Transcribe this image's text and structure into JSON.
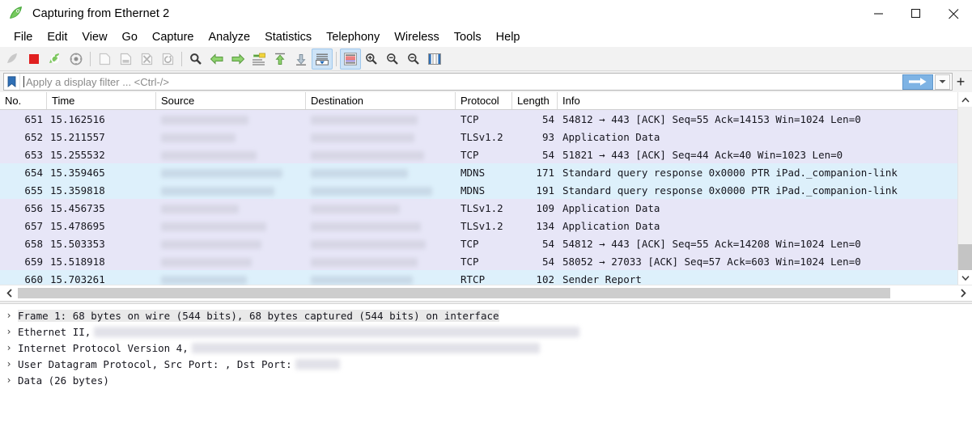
{
  "window": {
    "title": "Capturing from Ethernet 2",
    "app_icon": "wireshark-fin-icon",
    "controls": [
      {
        "name": "minimize",
        "glyph": "minimize-icon"
      },
      {
        "name": "maximize",
        "glyph": "maximize-icon"
      },
      {
        "name": "close",
        "glyph": "close-icon"
      }
    ]
  },
  "menubar": {
    "items": [
      "File",
      "Edit",
      "View",
      "Go",
      "Capture",
      "Analyze",
      "Statistics",
      "Telephony",
      "Wireless",
      "Tools",
      "Help"
    ]
  },
  "toolbar": {
    "buttons": [
      {
        "name": "start-capture-icon",
        "state": "disabled"
      },
      {
        "name": "stop-capture-icon",
        "state": "enabled"
      },
      {
        "name": "restart-capture-icon",
        "state": "enabled"
      },
      {
        "name": "capture-options-icon",
        "state": "enabled"
      },
      {
        "name": "separator",
        "state": "sep"
      },
      {
        "name": "open-file-icon",
        "state": "disabled"
      },
      {
        "name": "save-file-icon",
        "state": "disabled"
      },
      {
        "name": "close-file-icon",
        "state": "disabled"
      },
      {
        "name": "reload-file-icon",
        "state": "disabled"
      },
      {
        "name": "separator",
        "state": "sep"
      },
      {
        "name": "find-packet-icon",
        "state": "enabled"
      },
      {
        "name": "go-back-icon",
        "state": "enabled"
      },
      {
        "name": "go-forward-icon",
        "state": "enabled"
      },
      {
        "name": "go-to-packet-icon",
        "state": "enabled"
      },
      {
        "name": "go-to-first-packet-icon",
        "state": "enabled"
      },
      {
        "name": "go-to-last-packet-icon",
        "state": "enabled"
      },
      {
        "name": "auto-scroll-icon",
        "state": "active"
      },
      {
        "name": "separator",
        "state": "sep"
      },
      {
        "name": "colorize-packets-icon",
        "state": "active"
      },
      {
        "name": "zoom-in-icon",
        "state": "enabled"
      },
      {
        "name": "zoom-out-icon",
        "state": "enabled"
      },
      {
        "name": "normal-size-icon",
        "state": "enabled"
      },
      {
        "name": "resize-columns-icon",
        "state": "enabled"
      }
    ]
  },
  "filter": {
    "placeholder": "Apply a display filter ... <Ctrl-/>",
    "value": "",
    "bookmark_icon": "filter-bookmark-icon",
    "apply_icon": "apply-filter-arrow-icon",
    "dropdown_icon": "filter-history-dropdown-icon",
    "add_icon": "add-filter-button-icon"
  },
  "packet_list": {
    "columns": [
      {
        "key": "no",
        "label": "No."
      },
      {
        "key": "time",
        "label": "Time"
      },
      {
        "key": "src",
        "label": "Source"
      },
      {
        "key": "dst",
        "label": "Destination"
      },
      {
        "key": "proto",
        "label": "Protocol"
      },
      {
        "key": "len",
        "label": "Length"
      },
      {
        "key": "info",
        "label": "Info"
      }
    ],
    "rows": [
      {
        "no": "651",
        "time": "15.162516",
        "src": "",
        "dst": "",
        "proto": "TCP",
        "len": "54",
        "info": "54812 → 443 [ACK] Seq=55 Ack=14153 Win=1024 Len=0",
        "style": "tcp"
      },
      {
        "no": "652",
        "time": "15.211557",
        "src": "",
        "dst": "",
        "proto": "TLSv1.2",
        "len": "93",
        "info": "Application Data",
        "style": "tcp"
      },
      {
        "no": "653",
        "time": "15.255532",
        "src": "",
        "dst": "",
        "proto": "TCP",
        "len": "54",
        "info": "51821 → 443 [ACK] Seq=44 Ack=40 Win=1023 Len=0",
        "style": "tcp"
      },
      {
        "no": "654",
        "time": "15.359465",
        "src": "",
        "dst": "",
        "proto": "MDNS",
        "len": "171",
        "info": "Standard query response 0x0000 PTR iPad._companion-link",
        "style": "blue"
      },
      {
        "no": "655",
        "time": "15.359818",
        "src": "",
        "dst": "",
        "proto": "MDNS",
        "len": "191",
        "info": "Standard query response 0x0000 PTR iPad._companion-link",
        "style": "blue"
      },
      {
        "no": "656",
        "time": "15.456735",
        "src": "",
        "dst": "",
        "proto": "TLSv1.2",
        "len": "109",
        "info": "Application Data",
        "style": "tcp"
      },
      {
        "no": "657",
        "time": "15.478695",
        "src": "",
        "dst": "",
        "proto": "TLSv1.2",
        "len": "134",
        "info": "Application Data",
        "style": "tcp"
      },
      {
        "no": "658",
        "time": "15.503353",
        "src": "",
        "dst": "",
        "proto": "TCP",
        "len": "54",
        "info": "54812 → 443 [ACK] Seq=55 Ack=14208 Win=1024 Len=0",
        "style": "tcp"
      },
      {
        "no": "659",
        "time": "15.518918",
        "src": "",
        "dst": "",
        "proto": "TCP",
        "len": "54",
        "info": "58052 → 27033 [ACK] Seq=57 Ack=603 Win=1024 Len=0",
        "style": "tcp"
      },
      {
        "no": "660",
        "time": "15.703261",
        "src": "",
        "dst": "",
        "proto": "RTCP",
        "len": "102",
        "info": "Sender Report",
        "style": "blue"
      }
    ]
  },
  "packet_detail": {
    "rows": [
      {
        "expander": "›",
        "text": "Frame 1: 68 bytes on wire (544 bits), 68 bytes captured (544 bits) on interface",
        "selected": true,
        "redact_after": 0
      },
      {
        "expander": "›",
        "text": "Ethernet II,",
        "selected": false,
        "redact_after": 600
      },
      {
        "expander": "›",
        "text": "Internet Protocol Version 4,",
        "selected": false,
        "redact_after": 430
      },
      {
        "expander": "›",
        "text": "User Datagram Protocol, Src Port:    , Dst Port:",
        "selected": false,
        "redact_after": 55
      },
      {
        "expander": "›",
        "text": "Data (26 bytes)",
        "selected": false,
        "redact_after": 0
      }
    ]
  },
  "colors": {
    "row_tcp": "#e7e6f7",
    "row_other": "#ddf0fb",
    "toolbar_bg": "#f2f2f2",
    "active_btn": "#cde3f7",
    "apply_btn": "#7eb3e4",
    "wireshark_green": "#36b03c",
    "stop_red": "#e02020"
  }
}
